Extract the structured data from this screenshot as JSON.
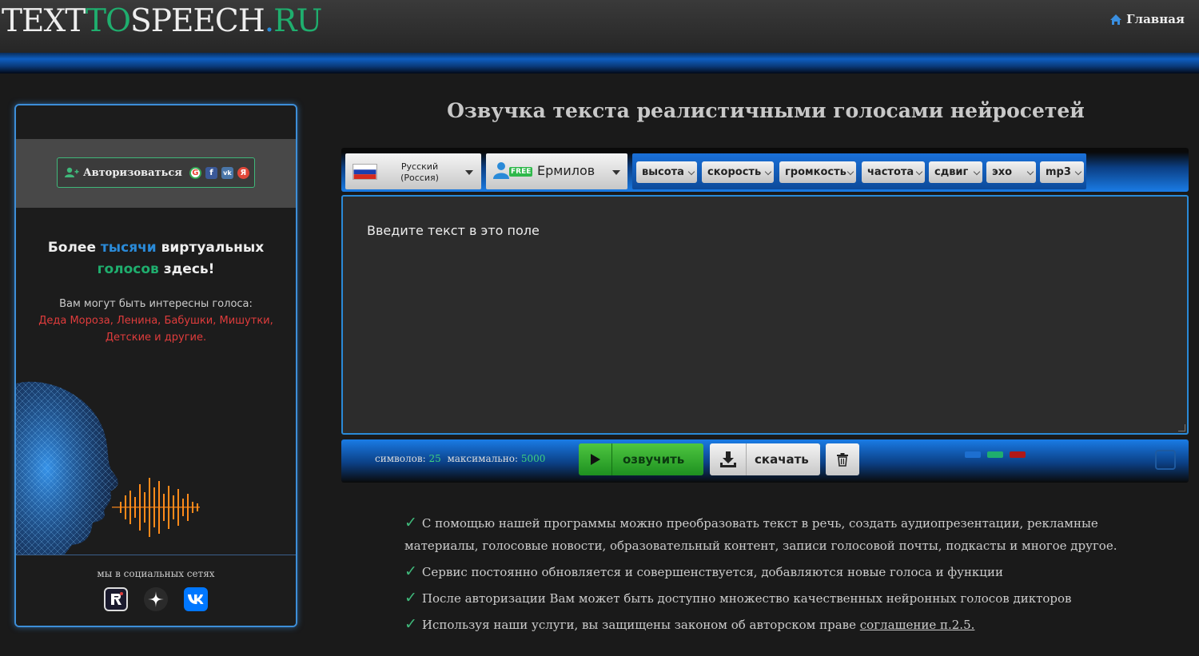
{
  "header": {
    "logo_parts": [
      "TEXT",
      "TO",
      "SPEECH",
      ".",
      "RU"
    ],
    "nav_home": "Главная",
    "nav_home_icon": "home-icon"
  },
  "sidebar": {
    "auth_button": "Авторизоваться",
    "auth_providers": [
      "G",
      "f",
      "vk",
      "Я"
    ],
    "promo_title": {
      "part1": "Более ",
      "part2": "тысячи",
      "part3": " виртуальных",
      "part4": "голосов",
      "part5": " здесь!"
    },
    "promo_sub": "Вам могут быть интересны голоса:",
    "promo_voices": {
      "v1": "Деда Мороза",
      "sep1": ", ",
      "v2": "Ленина",
      "sep2": ", ",
      "v3": "Бабушки",
      "sep3": ", ",
      "v4": "Мишутки",
      "sep4": ",",
      "v5": "Детские и другие",
      "end": "."
    },
    "social_title": "мы в социальных сетях",
    "social_icons": [
      "rutube-icon",
      "dzen-icon",
      "vk-icon"
    ]
  },
  "main": {
    "title": "Озвучка текста реалистичными голосами нейросетей",
    "language": {
      "line1": "Русский",
      "line2": "(Россия)"
    },
    "voice": {
      "badge": "FREE",
      "name": "Ермилов"
    },
    "params": [
      "высота",
      "скорость",
      "громкость",
      "частота",
      "сдвиг",
      "эхо",
      "mp3"
    ],
    "textarea_text": "Введите текст в это поле",
    "counter": {
      "symbols_label": "символов:",
      "symbols": "25",
      "max_label": "максимально:",
      "max": "5000"
    },
    "play_label": "озвучить",
    "download_label": "скачать",
    "theme_colors": [
      "#1d6fd0",
      "#1fae6e",
      "#b01818"
    ]
  },
  "features": [
    {
      "text": "С помощью нашей программы можно преобразовать текст в речь, создать аудиопрезентации, рекламные материалы, голосовые новости, образовательный контент, записи голосовой почты, подкасты и многое другое."
    },
    {
      "text": "Сервис постоянно обновляется и совершенствуется, добавляются новые голоса и функции"
    },
    {
      "text": "После авторизации Вам может быть доступно множество качественных нейронных голосов дикторов"
    },
    {
      "text": "Используя наши услуги, вы защищены законом об авторском праве ",
      "link": "соглашение п.2.5."
    }
  ],
  "colors": {
    "accent_blue": "#2a8ad8",
    "accent_green": "#1fae6e",
    "voice_red": "#e03c3c",
    "background": "#1a1a1a"
  }
}
